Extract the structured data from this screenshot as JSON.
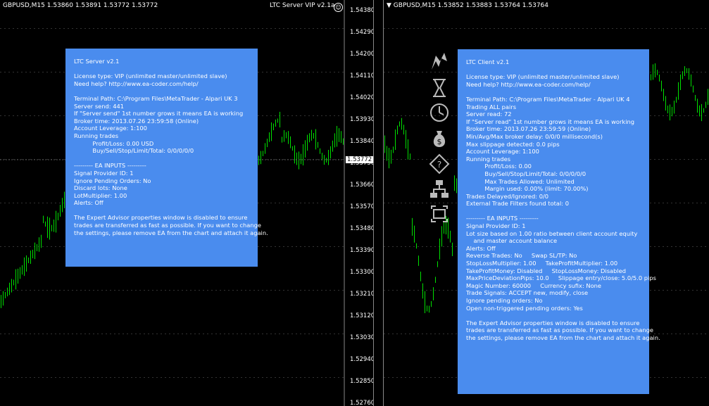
{
  "left_chart": {
    "header": "GBPUSD,M15  1.53860 1.53891 1.53772 1.53772",
    "ea_label": "LTC Server VIP  v2.1a",
    "price_axis": [
      "1.54380",
      "1.54290",
      "1.54200",
      "1.54110",
      "1.54020",
      "1.53930",
      "1.53840",
      "1.53750",
      "1.53660",
      "1.53570",
      "1.53480",
      "1.53390",
      "1.53300",
      "1.53210",
      "1.53120",
      "1.53030",
      "1.52940",
      "1.52850",
      "1.52760"
    ],
    "current_price": "1.53772",
    "panel_lines": [
      "LTC Server v2.1",
      "",
      "License type: VIP (unlimited master/unlimited slave)",
      "Need help? http://www.ea-coder.com/help/",
      "",
      "Terminal Path: C:\\Program Files\\MetaTrader - Alpari UK 3",
      "Server send: 441",
      "If \"Server send\" 1st number grows it means EA is working",
      "Broker time: 2013.07.26 23:59:58 (Online)",
      "Account Leverage: 1:100",
      "Running trades",
      "          Profit/Loss: 0.00 USD",
      "          Buy/Sell/Stop/Limit/Total: 0/0/0/0/0",
      "",
      "--------- EA INPUTS ---------",
      "Signal Provider ID: 1",
      "Ignore Pending Orders: No",
      "Discard lots: None",
      "LotMultiplier: 1.00",
      "Alerts: Off",
      "",
      "The Expert Advisor properties window is disabled to ensure",
      "trades are transferred as fast as possible. If you want to change",
      "the settings, please remove EA from the chart and attach it again."
    ]
  },
  "right_chart": {
    "header": "GBPUSD,M15  1.53852 1.53883 1.53764 1.53764",
    "panel_lines": [
      "LTC Client v2.1",
      "",
      "License type: VIP (unlimited master/unlimited slave)",
      "Need help? http://www.ea-coder.com/help/",
      "",
      "Terminal Path: C:\\Program Files\\MetaTrader - Alpari UK 4",
      "Trading ALL pairs",
      "Server read: 72",
      "If \"Server read\" 1st number grows it means EA is working",
      "Broker time: 2013.07.26 23:59:59 (Online)",
      "Min/Avg/Max broker delay: 0/0/0 millisecond(s)",
      "Max slippage detected: 0.0 pips",
      "Account Leverage: 1:100",
      "Running trades",
      "          Profit/Loss: 0.00",
      "          Buy/Sell/Stop/Limit/Total: 0/0/0/0/0",
      "          Max Trades Allowed: Unlimited",
      "          Margin used: 0.00% (limit: 70.00%)",
      "Trades Delayed/Ignored: 0/0",
      "External Trade Filters found total: 0",
      "",
      "--------- EA INPUTS ---------",
      "Signal Provider ID: 1",
      "Lot size based on 1.00 ratio between client account equity",
      "    and master account balance",
      "Alerts: Off",
      "Reverse Trades: No     Swap SL/TP: No",
      "StopLossMultiplier: 1.00     TakeProfitMultiplier: 1.00",
      "TakeProfitMoney: Disabled     StopLossMoney: Disabled",
      "MaxPriceDeviationPips: 10.0     Slippage entry/close: 5.0/5.0 pips",
      "Magic Number: 60000     Currency sufix: None",
      "Trade Signals: ACCEPT new, modify, close",
      "Ignore pending orders: No",
      "Open non-triggered pending orders: Yes",
      "",
      "The Expert Advisor properties window is disabled to ensure",
      "trades are transferred as fast as possible. If you want to change",
      "the settings, please remove EA from the chart and attach it again."
    ],
    "side_icons": [
      "lightning-icon",
      "hourglass-icon",
      "clock-icon",
      "money-bag-icon",
      "question-diamond-icon",
      "network-icon",
      "refresh-frame-icon"
    ]
  }
}
